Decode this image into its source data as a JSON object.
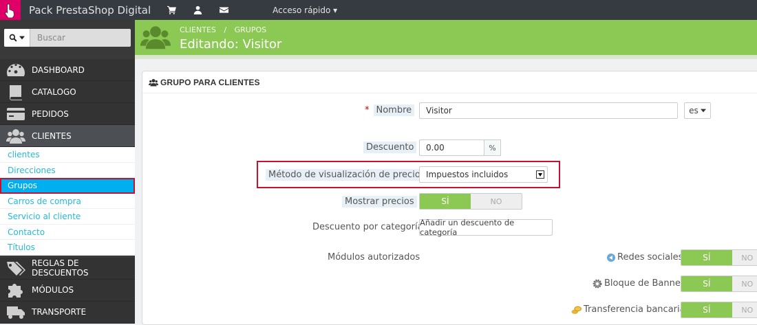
{
  "topbar": {
    "brand": "Pack PrestaShop Digital",
    "quick_access": "Acceso rápido ▾"
  },
  "sidebar": {
    "search_placeholder": "Buscar",
    "menu": [
      {
        "label": "DASHBOARD",
        "icon": "dashboard-icon"
      },
      {
        "label": "CATALOGO",
        "icon": "book-icon"
      },
      {
        "label": "PEDIDOS",
        "icon": "credit-card-icon"
      },
      {
        "label": "CLIENTES",
        "icon": "users-icon"
      }
    ],
    "submenu": [
      "clientes",
      "Direcciones",
      "Grupos",
      "Carros de compra",
      "Servicio al cliente",
      "Contacto",
      "Títulos"
    ],
    "menu_bottom": [
      {
        "label": "REGLAS DE DESCUENTOS",
        "icon": "tags-icon"
      },
      {
        "label": "MÓDULOS",
        "icon": "puzzle-icon"
      },
      {
        "label": "TRANSPORTE",
        "icon": "truck-icon"
      }
    ]
  },
  "header": {
    "breadcrumb": [
      "CLIENTES",
      "/",
      "GRUPOS"
    ],
    "title": "Editando: Visitor"
  },
  "form": {
    "panel_title": "GRUPO PARA CLIENTES",
    "name_label": "Nombre",
    "name_value": "Visitor",
    "lang": "es",
    "discount_label": "Descuento",
    "discount_value": "0.00",
    "discount_unit": "%",
    "price_display_label": "Método de visualización de precios",
    "price_display_value": "Impuestos incluidos",
    "show_prices_label": "Mostrar precios",
    "yes": "SÍ",
    "no": "NO",
    "category_discount_label": "Descuento por categoría",
    "category_discount_button": "Añadir un descuento de categoría",
    "modules_label": "Módulos autorizados",
    "modules": [
      "Redes sociales",
      "Bloque de Banner",
      "Transferencia bancaria"
    ]
  },
  "colors": {
    "accent_green": "#8bc954",
    "topbar": "#363a41",
    "link_blue": "#25b9d7",
    "logo_pink": "#df0067"
  }
}
